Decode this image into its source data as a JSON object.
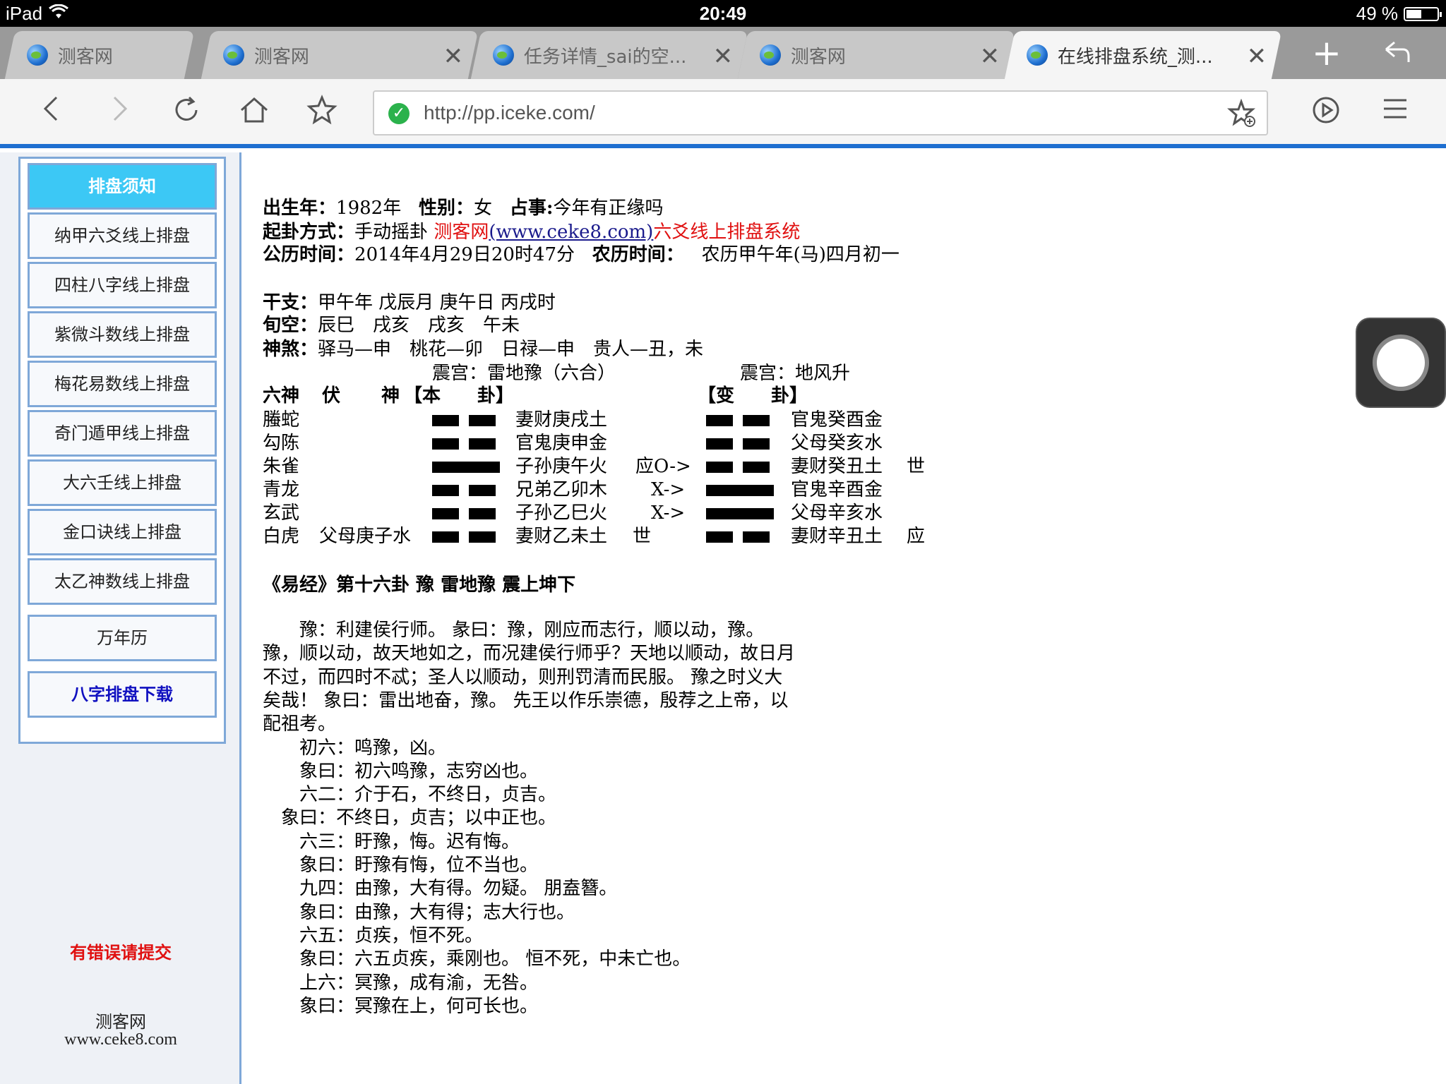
{
  "status": {
    "device": "iPad",
    "time": "20:49",
    "battery": "49 %",
    "battery_level": 0.49
  },
  "tabs": [
    {
      "title": "测客网",
      "closable": false
    },
    {
      "title": "测客网",
      "closable": true
    },
    {
      "title": "任务详情_sai的空...",
      "closable": true
    },
    {
      "title": "测客网",
      "closable": true
    },
    {
      "title": "在线排盘系统_测...",
      "closable": true,
      "active": true
    }
  ],
  "toolbar": {
    "url": "http://pp.iceke.com/"
  },
  "sidebar": {
    "items": [
      "排盘须知",
      "纳甲六爻线上排盘",
      "四柱八字线上排盘",
      "紫微斗数线上排盘",
      "梅花易数线上排盘",
      "奇门遁甲线上排盘",
      "大六壬线上排盘",
      "金口诀线上排盘",
      "太乙神数线上排盘",
      "万年历",
      "八字排盘下载"
    ],
    "error_link": "有错误请提交",
    "footer_name": "测客网",
    "footer_url": "www.ceke8.com"
  },
  "info": {
    "birth_label": "出生年",
    "birth_value": "1982年",
    "gender_label": "性别",
    "gender_value": "女",
    "question_label": "占事:",
    "question_value": "今年有正缘吗",
    "method_label": "起卦方式",
    "method_value": "手动摇卦",
    "site_name": "测客网",
    "site_url": "(www.ceke8.com)",
    "site_system": "六爻线上排盘系统",
    "solar_label": "公历时间",
    "solar_value": "2014年4月29日20时47分",
    "lunar_label": "农历时间",
    "lunar_value": "农历甲午年(马)四月初一",
    "ganzhi_label": "干支",
    "ganzhi_value": "甲午年 戊辰月 庚午日 丙戌时",
    "xunkong_label": "旬空",
    "xunkong_value": "辰巳　戌亥　戌亥　午未",
    "shensha_label": "神煞",
    "shensha_value": "驿马—申　桃花—卯　日禄—申　贵人—丑，未"
  },
  "hexagram": {
    "ben_palace": "震宫：雷地豫（六合）",
    "bian_palace": "震宫：地风升",
    "headers": {
      "liushen": "六神",
      "fu": "伏",
      "shen": "神",
      "ben": "【本　　卦】",
      "bian": "【变　　卦】"
    },
    "rows": [
      {
        "liushen": "螣蛇",
        "fushen": "",
        "ben_yin": true,
        "ben_text": "妻财庚戌土",
        "mark": "",
        "bian_yin": true,
        "bian_text": "官鬼癸酉金",
        "shiying": ""
      },
      {
        "liushen": "勾陈",
        "fushen": "",
        "ben_yin": true,
        "ben_text": "官鬼庚申金",
        "mark": "",
        "bian_yin": true,
        "bian_text": "父母癸亥水",
        "shiying": ""
      },
      {
        "liushen": "朱雀",
        "fushen": "",
        "ben_yin": false,
        "ben_text": "子孙庚午火",
        "mark": "应O->",
        "bian_yin": true,
        "bian_text": "妻财癸丑土",
        "shiying": "世"
      },
      {
        "liushen": "青龙",
        "fushen": "",
        "ben_yin": true,
        "ben_text": "兄弟乙卯木",
        "mark": "X->",
        "bian_yin": false,
        "bian_text": "官鬼辛酉金",
        "shiying": ""
      },
      {
        "liushen": "玄武",
        "fushen": "",
        "ben_yin": true,
        "ben_text": "子孙乙巳火",
        "mark": "X->",
        "bian_yin": false,
        "bian_text": "父母辛亥水",
        "shiying": ""
      },
      {
        "liushen": "白虎",
        "fushen": "父母庚子水",
        "ben_yin": true,
        "ben_text": "妻财乙未土",
        "mark": "世",
        "bian_yin": true,
        "bian_text": "妻财辛丑土",
        "shiying": "应"
      }
    ]
  },
  "yijing": {
    "title": "《易经》第十六卦 豫 雷地豫 震上坤下",
    "lines": [
      "　　豫：利建侯行师。 彖曰：豫，刚应而志行，顺以动，豫。",
      "豫，顺以动，故天地如之，而况建侯行师乎？天地以顺动，故日月",
      "不过，而四时不忒；圣人以顺动，则刑罚清而民服。 豫之时义大",
      "矣哉！ 象曰：雷出地奋，豫。 先王以作乐崇德，殷荐之上帝，以",
      "配祖考。",
      "　　初六：鸣豫，凶。",
      "　　象曰：初六鸣豫，志穷凶也。",
      "　　六二：介于石，不终日，贞吉。",
      "　象曰：不终日，贞吉；以中正也。",
      "　　六三：盱豫，悔。迟有悔。",
      "　　象曰：盱豫有悔，位不当也。",
      "　　九四：由豫，大有得。勿疑。 朋盍簪。",
      "　　象曰：由豫，大有得；志大行也。",
      "　　六五：贞疾，恒不死。",
      "　　象曰：六五贞疾，乘刚也。 恒不死，中未亡也。",
      "　　上六：冥豫，成有渝，无咎。",
      "　　象曰：冥豫在上，何可长也。"
    ]
  }
}
